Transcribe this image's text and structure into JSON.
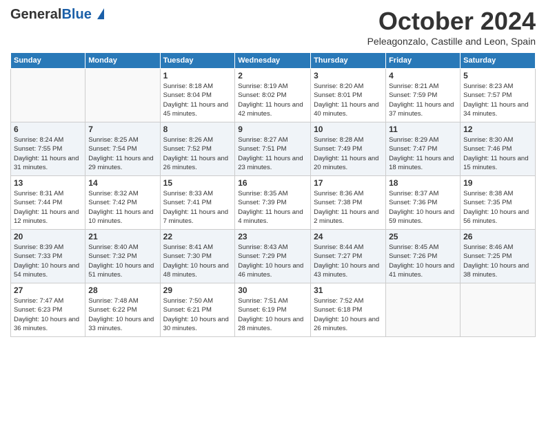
{
  "header": {
    "logo_line1": "General",
    "logo_line2": "Blue",
    "month_title": "October 2024",
    "location": "Peleagonzalo, Castille and Leon, Spain"
  },
  "weekdays": [
    "Sunday",
    "Monday",
    "Tuesday",
    "Wednesday",
    "Thursday",
    "Friday",
    "Saturday"
  ],
  "weeks": [
    [
      {
        "day": "",
        "info": ""
      },
      {
        "day": "",
        "info": ""
      },
      {
        "day": "1",
        "info": "Sunrise: 8:18 AM\nSunset: 8:04 PM\nDaylight: 11 hours and 45 minutes."
      },
      {
        "day": "2",
        "info": "Sunrise: 8:19 AM\nSunset: 8:02 PM\nDaylight: 11 hours and 42 minutes."
      },
      {
        "day": "3",
        "info": "Sunrise: 8:20 AM\nSunset: 8:01 PM\nDaylight: 11 hours and 40 minutes."
      },
      {
        "day": "4",
        "info": "Sunrise: 8:21 AM\nSunset: 7:59 PM\nDaylight: 11 hours and 37 minutes."
      },
      {
        "day": "5",
        "info": "Sunrise: 8:23 AM\nSunset: 7:57 PM\nDaylight: 11 hours and 34 minutes."
      }
    ],
    [
      {
        "day": "6",
        "info": "Sunrise: 8:24 AM\nSunset: 7:55 PM\nDaylight: 11 hours and 31 minutes."
      },
      {
        "day": "7",
        "info": "Sunrise: 8:25 AM\nSunset: 7:54 PM\nDaylight: 11 hours and 29 minutes."
      },
      {
        "day": "8",
        "info": "Sunrise: 8:26 AM\nSunset: 7:52 PM\nDaylight: 11 hours and 26 minutes."
      },
      {
        "day": "9",
        "info": "Sunrise: 8:27 AM\nSunset: 7:51 PM\nDaylight: 11 hours and 23 minutes."
      },
      {
        "day": "10",
        "info": "Sunrise: 8:28 AM\nSunset: 7:49 PM\nDaylight: 11 hours and 20 minutes."
      },
      {
        "day": "11",
        "info": "Sunrise: 8:29 AM\nSunset: 7:47 PM\nDaylight: 11 hours and 18 minutes."
      },
      {
        "day": "12",
        "info": "Sunrise: 8:30 AM\nSunset: 7:46 PM\nDaylight: 11 hours and 15 minutes."
      }
    ],
    [
      {
        "day": "13",
        "info": "Sunrise: 8:31 AM\nSunset: 7:44 PM\nDaylight: 11 hours and 12 minutes."
      },
      {
        "day": "14",
        "info": "Sunrise: 8:32 AM\nSunset: 7:42 PM\nDaylight: 11 hours and 10 minutes."
      },
      {
        "day": "15",
        "info": "Sunrise: 8:33 AM\nSunset: 7:41 PM\nDaylight: 11 hours and 7 minutes."
      },
      {
        "day": "16",
        "info": "Sunrise: 8:35 AM\nSunset: 7:39 PM\nDaylight: 11 hours and 4 minutes."
      },
      {
        "day": "17",
        "info": "Sunrise: 8:36 AM\nSunset: 7:38 PM\nDaylight: 11 hours and 2 minutes."
      },
      {
        "day": "18",
        "info": "Sunrise: 8:37 AM\nSunset: 7:36 PM\nDaylight: 10 hours and 59 minutes."
      },
      {
        "day": "19",
        "info": "Sunrise: 8:38 AM\nSunset: 7:35 PM\nDaylight: 10 hours and 56 minutes."
      }
    ],
    [
      {
        "day": "20",
        "info": "Sunrise: 8:39 AM\nSunset: 7:33 PM\nDaylight: 10 hours and 54 minutes."
      },
      {
        "day": "21",
        "info": "Sunrise: 8:40 AM\nSunset: 7:32 PM\nDaylight: 10 hours and 51 minutes."
      },
      {
        "day": "22",
        "info": "Sunrise: 8:41 AM\nSunset: 7:30 PM\nDaylight: 10 hours and 48 minutes."
      },
      {
        "day": "23",
        "info": "Sunrise: 8:43 AM\nSunset: 7:29 PM\nDaylight: 10 hours and 46 minutes."
      },
      {
        "day": "24",
        "info": "Sunrise: 8:44 AM\nSunset: 7:27 PM\nDaylight: 10 hours and 43 minutes."
      },
      {
        "day": "25",
        "info": "Sunrise: 8:45 AM\nSunset: 7:26 PM\nDaylight: 10 hours and 41 minutes."
      },
      {
        "day": "26",
        "info": "Sunrise: 8:46 AM\nSunset: 7:25 PM\nDaylight: 10 hours and 38 minutes."
      }
    ],
    [
      {
        "day": "27",
        "info": "Sunrise: 7:47 AM\nSunset: 6:23 PM\nDaylight: 10 hours and 36 minutes."
      },
      {
        "day": "28",
        "info": "Sunrise: 7:48 AM\nSunset: 6:22 PM\nDaylight: 10 hours and 33 minutes."
      },
      {
        "day": "29",
        "info": "Sunrise: 7:50 AM\nSunset: 6:21 PM\nDaylight: 10 hours and 30 minutes."
      },
      {
        "day": "30",
        "info": "Sunrise: 7:51 AM\nSunset: 6:19 PM\nDaylight: 10 hours and 28 minutes."
      },
      {
        "day": "31",
        "info": "Sunrise: 7:52 AM\nSunset: 6:18 PM\nDaylight: 10 hours and 26 minutes."
      },
      {
        "day": "",
        "info": ""
      },
      {
        "day": "",
        "info": ""
      }
    ]
  ]
}
